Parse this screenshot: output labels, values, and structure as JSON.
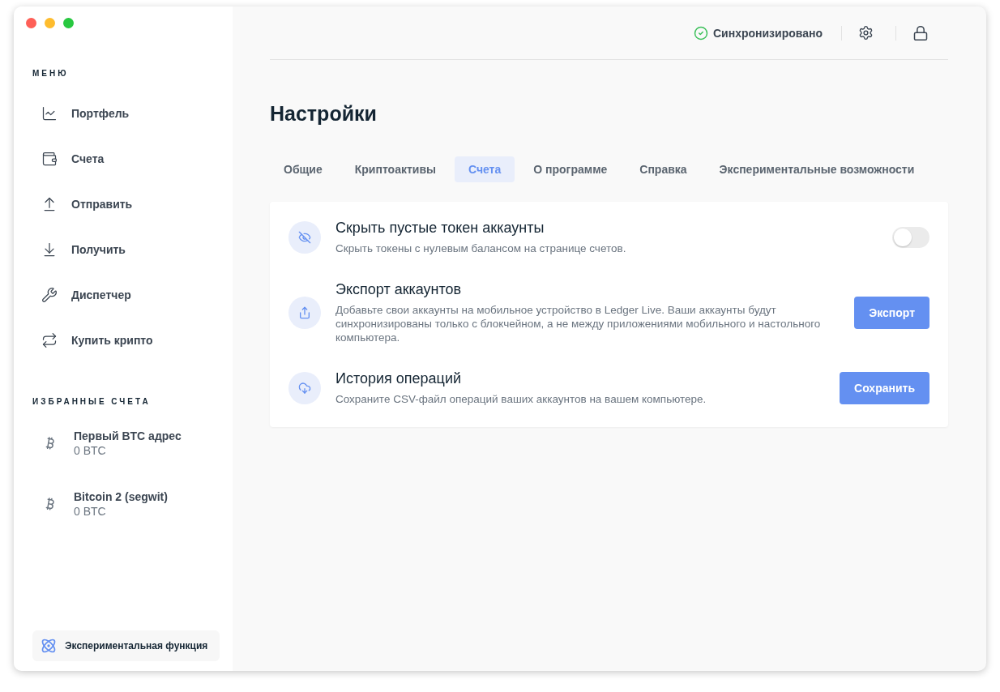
{
  "window": {
    "controls": [
      {
        "color": "#fe5f57"
      },
      {
        "color": "#febc2e"
      },
      {
        "color": "#28c840"
      }
    ]
  },
  "sidebar": {
    "menu_title": "МЕНЮ",
    "items": [
      {
        "label": "Портфель",
        "selected": false
      },
      {
        "label": "Счета",
        "selected": false
      },
      {
        "label": "Отправить",
        "selected": false
      },
      {
        "label": "Получить",
        "selected": false
      },
      {
        "label": "Диспетчер",
        "selected": false
      },
      {
        "label": "Купить крипто",
        "selected": false
      }
    ],
    "favorites_title": "ИЗБРАННЫЕ СЧЕТА",
    "favorites": [
      {
        "name": "Первый BTC адрес",
        "balance": "0 BTC"
      },
      {
        "name": "Bitcoin 2 (segwit)",
        "balance": "0 BTC"
      }
    ],
    "experimental_button": "Экспериментальная функция"
  },
  "topbar": {
    "sync_status": "Синхронизировано"
  },
  "page_title": "Настройки",
  "tabs": [
    {
      "label": "Общие",
      "selected": false
    },
    {
      "label": "Криптоактивы",
      "selected": false
    },
    {
      "label": "Счета",
      "selected": true
    },
    {
      "label": "О программе",
      "selected": false
    },
    {
      "label": "Справка",
      "selected": false
    },
    {
      "label": "Экспериментальные возможности",
      "selected": false
    }
  ],
  "settings": [
    {
      "kind": "toggle",
      "title": "Скрыть пустые токен аккаунты",
      "description": "Скрыть токены с нулевым балансом на странице счетов.",
      "on": false
    },
    {
      "kind": "button",
      "title": "Экспорт аккаунтов",
      "description": "Добавьте свои аккаунты на мобильное устройство в Ledger Live. Ваши аккаунты будут синхронизированы только с блокчейном, а не между приложениями мобильного и настольного компьютера.",
      "button": "Экспорт"
    },
    {
      "kind": "button",
      "title": "История операций",
      "description": "Сохраните CSV-файл операций ваших аккаунтов на вашем компьютере.",
      "button": "Сохранить"
    }
  ]
}
